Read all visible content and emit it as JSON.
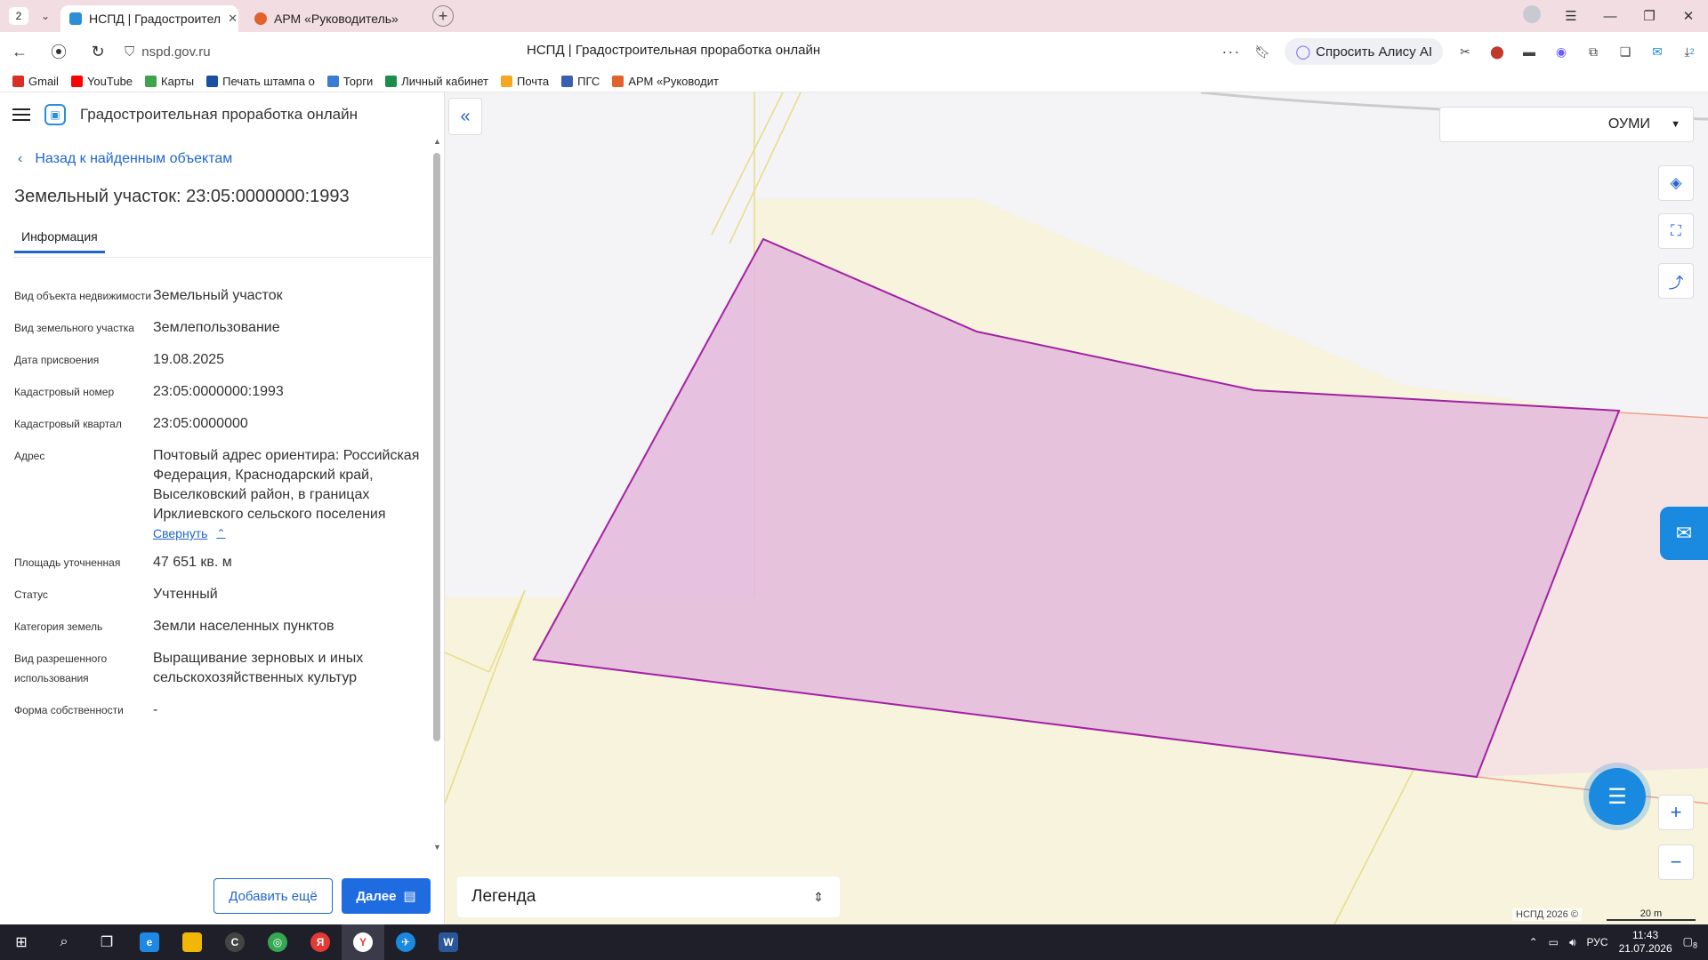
{
  "tabs": {
    "count": "2",
    "items": [
      {
        "label": "НСПД | Градостроител",
        "active": true
      },
      {
        "label": "АРМ «Руководитель»",
        "active": false
      }
    ]
  },
  "address": {
    "url": "nspd.gov.ru",
    "title": "НСПД | Градостроительная проработка онлайн",
    "alisa_label": "Спросить Алису AI",
    "notification_badge": "2"
  },
  "bookmarks": [
    {
      "label": "Gmail",
      "color": "#d93025"
    },
    {
      "label": "YouTube",
      "color": "#ff0000"
    },
    {
      "label": "Карты",
      "color": "#3fa34d"
    },
    {
      "label": "Печать штампа о",
      "color": "#1b4fa3"
    },
    {
      "label": "Торги",
      "color": "#3a7bd5"
    },
    {
      "label": "Личный кабинет",
      "color": "#1a8e4a"
    },
    {
      "label": "Почта",
      "color": "#f5a623"
    },
    {
      "label": "ПГС",
      "color": "#3a5fb0"
    },
    {
      "label": "АРМ «Руководит",
      "color": "#e2622c"
    }
  ],
  "app": {
    "title": "Градостроительная проработка онлайн",
    "back_link": "Назад к найденным объектам",
    "object_title": "Земельный участок: 23:05:0000000:1993",
    "tab_info": "Информация"
  },
  "properties": [
    {
      "key": "Вид объекта недвижимости",
      "value": "Земельный участок"
    },
    {
      "key": "Вид земельного участка",
      "value": "Землепользование"
    },
    {
      "key": "Дата присвоения",
      "value": "19.08.2025"
    },
    {
      "key": "Кадастровый номер",
      "value": "23:05:0000000:1993"
    },
    {
      "key": "Кадастровый квартал",
      "value": "23:05:0000000"
    },
    {
      "key": "Адрес",
      "value": "Почтовый адрес ориентира: Российская Федерация, Краснодарский край, Выселковский район, в границах Ирклиевского сельского поселения"
    },
    {
      "key": "Площадь уточненная",
      "value": "47 651 кв. м"
    },
    {
      "key": "Статус",
      "value": "Учтенный"
    },
    {
      "key": "Категория земель",
      "value": "Земли населенных пунктов"
    },
    {
      "key": "Вид разрешенного использования",
      "value": "Выращивание зерновых и иных сельскохозяйственных культур"
    },
    {
      "key": "Форма собственности",
      "value": "-"
    }
  ],
  "collapse_label": "Свернуть",
  "buttons": {
    "add_more": "Добавить ещё",
    "next": "Далее"
  },
  "map": {
    "layer_select": "ОУМИ",
    "legend": "Легенда",
    "copyright": "НСПД 2026 ©",
    "scale": "20 m",
    "parcel_fill": "#e3b8dc",
    "parcel_stroke": "#a321a3"
  },
  "taskbar": {
    "language": "РУС",
    "time": "11:43",
    "date": "21.07.2026",
    "notifications": "8"
  }
}
